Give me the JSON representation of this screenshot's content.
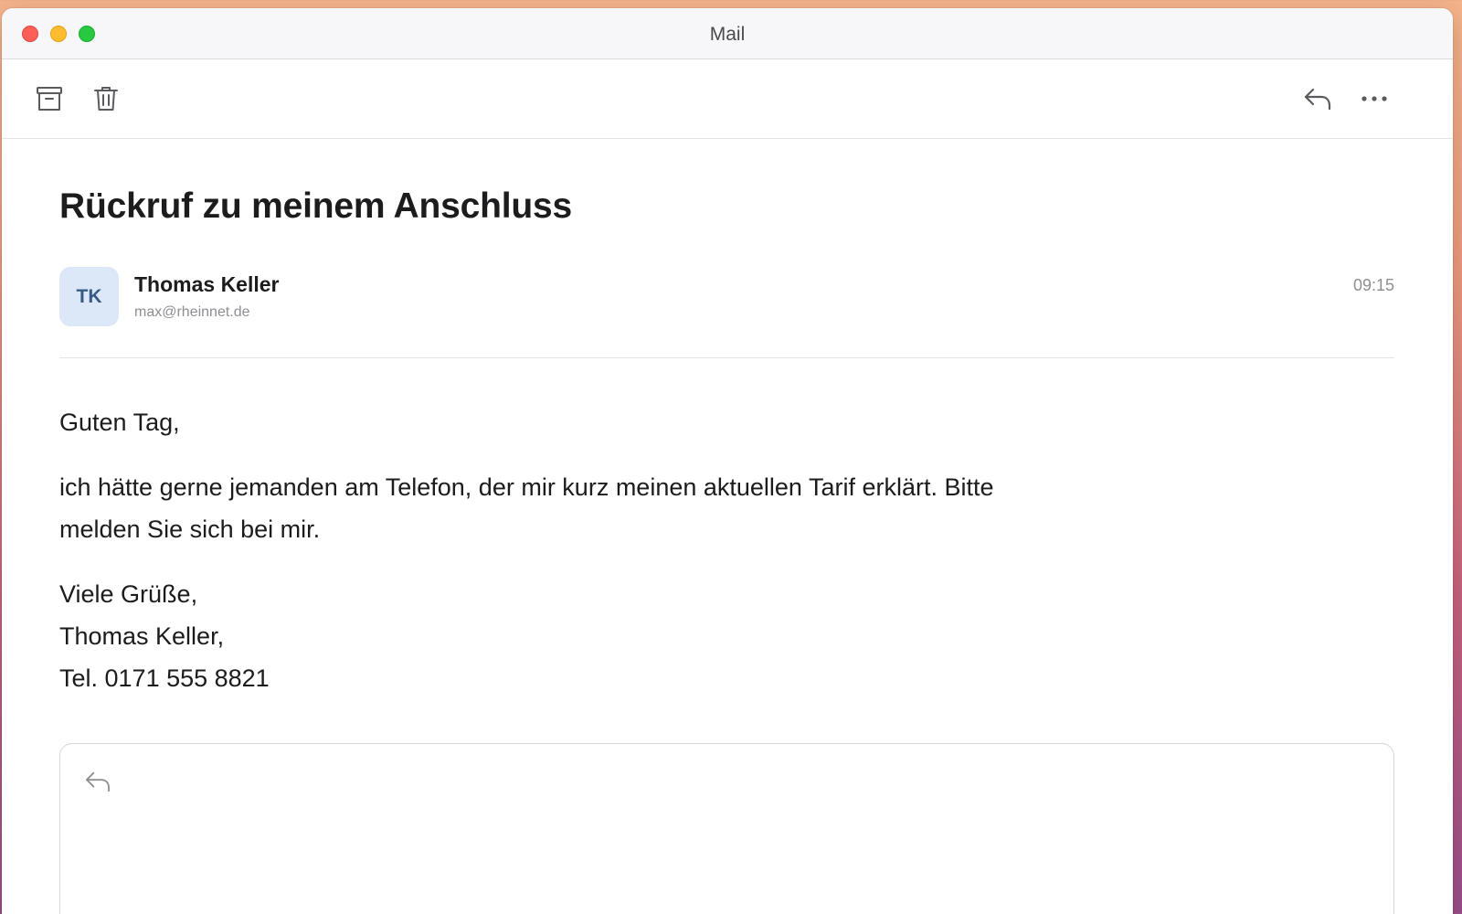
{
  "window": {
    "title": "Mail"
  },
  "toolbar": {
    "left_icons": [
      "archive-icon",
      "trash-icon"
    ],
    "right_icons": [
      "reply-icon",
      "more-icon"
    ]
  },
  "message": {
    "subject": "Rückruf zu meinem Anschluss",
    "sender": {
      "initials": "TK",
      "name": "Thomas Keller",
      "email": "max@rheinnet.de"
    },
    "time": "09:15",
    "body": {
      "greeting": "Guten Tag,",
      "paragraph": "ich hätte gerne jemanden am Telefon, der mir kurz meinen aktuellen Tarif erklärt. Bitte melden Sie sich bei mir.",
      "closing": [
        "Viele Grüße,",
        "Thomas Keller,",
        "Tel. 0171 555 8821"
      ]
    }
  },
  "reply": {
    "icon": "reply-icon",
    "text": ""
  },
  "colors": {
    "traffic_close": "#fe5f57",
    "traffic_minimize": "#febc2e",
    "traffic_zoom": "#28c840",
    "avatar_bg": "#dce8f8",
    "avatar_text": "#365b86",
    "secondary_text": "#8e8e93"
  }
}
